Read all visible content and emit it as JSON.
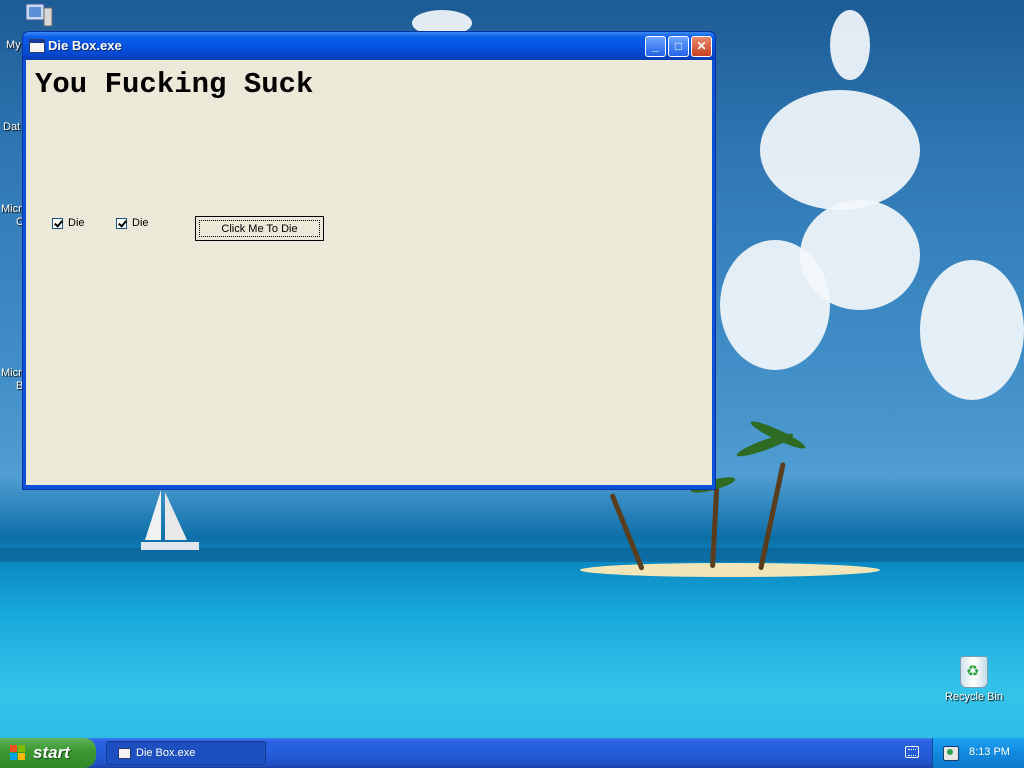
{
  "window": {
    "title": "Die Box.exe",
    "headline": "You Fucking Suck",
    "checkboxes": [
      {
        "label": "Die",
        "checked": true
      },
      {
        "label": "Die",
        "checked": true
      }
    ],
    "button_label": "Click Me To Die",
    "caption_buttons": {
      "minimize": "_",
      "maximize": "□",
      "close": "✕"
    }
  },
  "desktop": {
    "edge_labels": [
      "My",
      "Dat",
      "Micr",
      "C",
      "Micr",
      "B"
    ],
    "recycle_bin_label": "Recycle Bin"
  },
  "taskbar": {
    "start_label": "start",
    "tasks": [
      {
        "label": "Die Box.exe"
      }
    ],
    "clock": "8:13 PM"
  },
  "colors": {
    "window_frame": "#0a53d8",
    "client_background": "#ece9d8",
    "start_button": "#3c9a34",
    "taskbar": "#245edb",
    "tray": "#118ae0"
  }
}
